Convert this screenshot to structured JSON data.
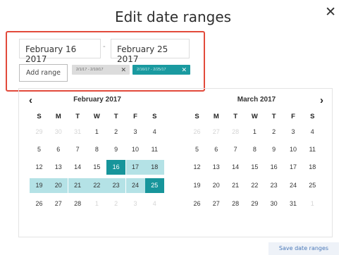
{
  "title": "Edit date ranges",
  "close_icon_glyph": "✕",
  "start_date": "February 16 2017",
  "end_date": "February 25 2017",
  "separator": "-",
  "add_range_label": "Add range",
  "chips": [
    {
      "label": "2/1/17 - 2/10/17",
      "remove_glyph": "✕"
    },
    {
      "label": "2/16/17 - 2/25/17",
      "remove_glyph": "✕"
    }
  ],
  "nav": {
    "prev_glyph": "‹",
    "next_glyph": "›"
  },
  "calendars": [
    {
      "month": "February 2017",
      "weekdays": [
        "S",
        "M",
        "T",
        "W",
        "T",
        "F",
        "S"
      ],
      "rows": [
        [
          {
            "d": "29",
            "m": true
          },
          {
            "d": "30",
            "m": true
          },
          {
            "d": "31",
            "m": true
          },
          {
            "d": "1"
          },
          {
            "d": "2"
          },
          {
            "d": "3"
          },
          {
            "d": "4"
          }
        ],
        [
          {
            "d": "5"
          },
          {
            "d": "6"
          },
          {
            "d": "7"
          },
          {
            "d": "8"
          },
          {
            "d": "9"
          },
          {
            "d": "10"
          },
          {
            "d": "11"
          }
        ],
        [
          {
            "d": "12"
          },
          {
            "d": "13"
          },
          {
            "d": "14"
          },
          {
            "d": "15"
          },
          {
            "d": "16",
            "s": "endpoint"
          },
          {
            "d": "17",
            "s": "range"
          },
          {
            "d": "18",
            "s": "range"
          }
        ],
        [
          {
            "d": "19",
            "s": "range"
          },
          {
            "d": "20",
            "s": "range"
          },
          {
            "d": "21",
            "s": "range"
          },
          {
            "d": "22",
            "s": "range"
          },
          {
            "d": "23",
            "s": "range"
          },
          {
            "d": "24",
            "s": "range"
          },
          {
            "d": "25",
            "s": "endpoint"
          }
        ],
        [
          {
            "d": "26"
          },
          {
            "d": "27"
          },
          {
            "d": "28"
          },
          {
            "d": "1",
            "m": true
          },
          {
            "d": "2",
            "m": true
          },
          {
            "d": "3",
            "m": true
          },
          {
            "d": "4",
            "m": true
          }
        ]
      ]
    },
    {
      "month": "March 2017",
      "weekdays": [
        "S",
        "M",
        "T",
        "W",
        "T",
        "F",
        "S"
      ],
      "rows": [
        [
          {
            "d": "26",
            "m": true
          },
          {
            "d": "27",
            "m": true
          },
          {
            "d": "28",
            "m": true
          },
          {
            "d": "1"
          },
          {
            "d": "2"
          },
          {
            "d": "3"
          },
          {
            "d": "4"
          }
        ],
        [
          {
            "d": "5"
          },
          {
            "d": "6"
          },
          {
            "d": "7"
          },
          {
            "d": "8"
          },
          {
            "d": "9"
          },
          {
            "d": "10"
          },
          {
            "d": "11"
          }
        ],
        [
          {
            "d": "12"
          },
          {
            "d": "13"
          },
          {
            "d": "14"
          },
          {
            "d": "15"
          },
          {
            "d": "16"
          },
          {
            "d": "17"
          },
          {
            "d": "18"
          }
        ],
        [
          {
            "d": "19"
          },
          {
            "d": "20"
          },
          {
            "d": "21"
          },
          {
            "d": "22"
          },
          {
            "d": "23"
          },
          {
            "d": "24"
          },
          {
            "d": "25"
          }
        ],
        [
          {
            "d": "26"
          },
          {
            "d": "27"
          },
          {
            "d": "28"
          },
          {
            "d": "29"
          },
          {
            "d": "30"
          },
          {
            "d": "31"
          },
          {
            "d": "1",
            "m": true
          }
        ]
      ]
    }
  ],
  "save_label": "Save date ranges",
  "colors": {
    "accent": "#17959b",
    "range_fill": "#b4e2e6",
    "highlight_border": "#e24a3b",
    "save_text": "#4a78b8"
  }
}
